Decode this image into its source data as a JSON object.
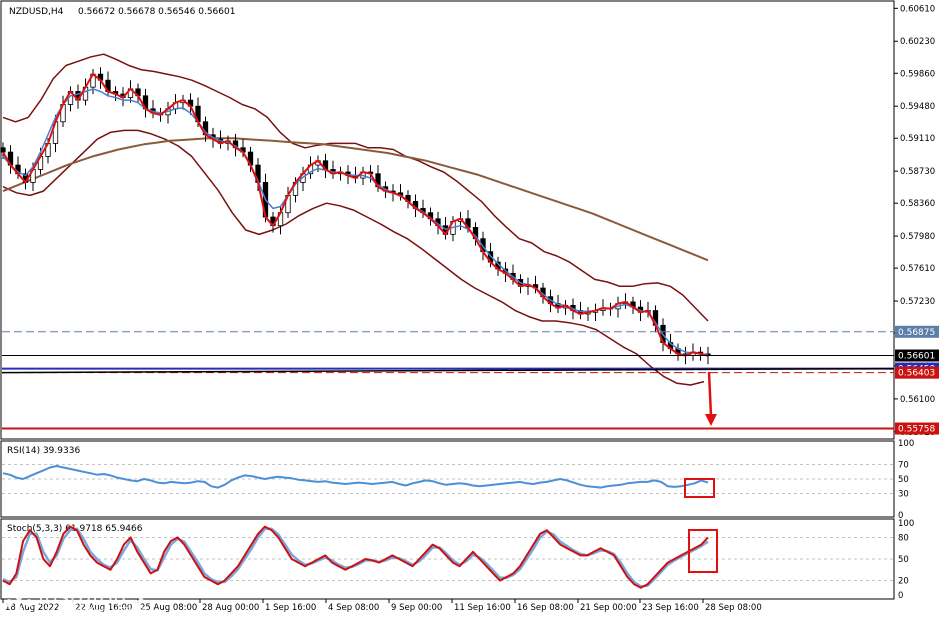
{
  "chart_data": {
    "type": "candlestick",
    "header": {
      "symbol": "NZDUSD,H4",
      "ohlc": "0.56672 0.56678 0.56546 0.56601"
    },
    "price_axis": {
      "ticks": [
        "0.60610",
        "0.60230",
        "0.59860",
        "0.59480",
        "0.59110",
        "0.58730",
        "0.58360",
        "0.57980",
        "0.57610",
        "0.57230",
        "0.56860",
        "0.56480",
        "0.56100",
        "0.55720"
      ],
      "ylim": [
        0.5566,
        0.6066
      ]
    },
    "time_axis": {
      "labels": [
        "18 Aug 2022",
        "22 Aug 16:00",
        "25 Aug 08:00",
        "28 Aug 00:00",
        "1 Sep 16:00",
        "4 Sep 08:00",
        "9 Sep 00:00",
        "11 Sep 16:00",
        "16 Sep 08:00",
        "21 Sep 00:00",
        "23 Sep 16:00",
        "28 Sep 08:00"
      ]
    },
    "series": {
      "close_path": [
        0.5895,
        0.588,
        0.587,
        0.586,
        0.5875,
        0.589,
        0.5905,
        0.593,
        0.595,
        0.5965,
        0.5955,
        0.597,
        0.5985,
        0.5978,
        0.5965,
        0.5962,
        0.5958,
        0.5968,
        0.596,
        0.5945,
        0.594,
        0.5938,
        0.5945,
        0.5952,
        0.5955,
        0.5948,
        0.593,
        0.5915,
        0.591,
        0.5905,
        0.5908,
        0.59,
        0.5895,
        0.588,
        0.586,
        0.582,
        0.581,
        0.5825,
        0.5845,
        0.586,
        0.587,
        0.588,
        0.5885,
        0.5875,
        0.587,
        0.5872,
        0.5868,
        0.5865,
        0.5872,
        0.587,
        0.5855,
        0.585,
        0.5848,
        0.5845,
        0.5838,
        0.583,
        0.5825,
        0.5818,
        0.581,
        0.58,
        0.5815,
        0.5818,
        0.5808,
        0.5795,
        0.578,
        0.5768,
        0.576,
        0.5755,
        0.5748,
        0.574,
        0.5742,
        0.5738,
        0.5728,
        0.572,
        0.5715,
        0.5718,
        0.5712,
        0.5708,
        0.571,
        0.5712,
        0.5715,
        0.5714,
        0.572,
        0.5722,
        0.5716,
        0.571,
        0.5712,
        0.5695,
        0.5675,
        0.5668,
        0.5662,
        0.566,
        0.5664,
        0.5662,
        0.566
      ],
      "ma_short": [
        0.589,
        0.588,
        0.5872,
        0.5868,
        0.5878,
        0.5895,
        0.5915,
        0.5935,
        0.595,
        0.596,
        0.5962,
        0.5965,
        0.5968,
        0.5965,
        0.596,
        0.5958,
        0.5955,
        0.5955,
        0.5952,
        0.5945,
        0.5942,
        0.594,
        0.5942,
        0.5945,
        0.5946,
        0.594,
        0.593,
        0.5918,
        0.5912,
        0.5908,
        0.5906,
        0.5902,
        0.5895,
        0.588,
        0.5862,
        0.584,
        0.583,
        0.5832,
        0.5845,
        0.5858,
        0.5866,
        0.5872,
        0.5876,
        0.5874,
        0.5872,
        0.5871,
        0.5869,
        0.5868,
        0.5868,
        0.5865,
        0.5857,
        0.5852,
        0.5848,
        0.5844,
        0.5838,
        0.5831,
        0.5826,
        0.5819,
        0.5812,
        0.5806,
        0.5808,
        0.581,
        0.5806,
        0.5798,
        0.5786,
        0.5775,
        0.5766,
        0.5758,
        0.5751,
        0.5744,
        0.5742,
        0.5738,
        0.5731,
        0.5724,
        0.5719,
        0.5718,
        0.5714,
        0.5711,
        0.5711,
        0.5712,
        0.5714,
        0.5714,
        0.5717,
        0.5719,
        0.5716,
        0.5712,
        0.571,
        0.5698,
        0.5684,
        0.5674,
        0.5668,
        0.5664,
        0.5663,
        0.5662,
        0.5661
      ],
      "ma_long": [
        0.585,
        0.5856,
        0.5862,
        0.5868,
        0.5874,
        0.588,
        0.5885,
        0.589,
        0.5894,
        0.5898,
        0.5901,
        0.5904,
        0.5906,
        0.5908,
        0.5909,
        0.591,
        0.5911,
        0.5911,
        0.5911,
        0.591,
        0.5909,
        0.5908,
        0.5907,
        0.5906,
        0.5905,
        0.5904,
        0.5902,
        0.59,
        0.5898,
        0.5896,
        0.5894,
        0.5891,
        0.5888,
        0.5885,
        0.5881,
        0.5877,
        0.5873,
        0.5869,
        0.5864,
        0.5859,
        0.5854,
        0.5849,
        0.5844,
        0.5839,
        0.5834,
        0.5829,
        0.5824,
        0.5818,
        0.5812,
        0.5806,
        0.58,
        0.5794,
        0.5788,
        0.5782,
        0.5776,
        0.577
      ],
      "bb_upper": [
        0.5935,
        0.593,
        0.5935,
        0.5955,
        0.598,
        0.5995,
        0.6,
        0.6005,
        0.6008,
        0.6002,
        0.5995,
        0.599,
        0.5988,
        0.5985,
        0.5982,
        0.5978,
        0.5972,
        0.5965,
        0.5958,
        0.595,
        0.5945,
        0.5935,
        0.5918,
        0.5905,
        0.59,
        0.5903,
        0.5905,
        0.5905,
        0.5905,
        0.59,
        0.59,
        0.5898,
        0.589,
        0.5885,
        0.5878,
        0.5872,
        0.5862,
        0.585,
        0.5838,
        0.5822,
        0.5808,
        0.5795,
        0.579,
        0.578,
        0.5775,
        0.5768,
        0.5758,
        0.5748,
        0.5745,
        0.574,
        0.574,
        0.5743,
        0.5744,
        0.574,
        0.573,
        0.5715,
        0.57
      ],
      "bb_lower": [
        0.5855,
        0.5848,
        0.5845,
        0.585,
        0.5865,
        0.588,
        0.5895,
        0.591,
        0.5918,
        0.592,
        0.592,
        0.5916,
        0.591,
        0.5902,
        0.589,
        0.587,
        0.585,
        0.5825,
        0.5805,
        0.58,
        0.5805,
        0.5812,
        0.5822,
        0.583,
        0.5836,
        0.5833,
        0.5828,
        0.582,
        0.5812,
        0.5803,
        0.5795,
        0.5784,
        0.5772,
        0.576,
        0.5748,
        0.5738,
        0.573,
        0.5722,
        0.5712,
        0.5705,
        0.57,
        0.57,
        0.5698,
        0.5695,
        0.569,
        0.568,
        0.567,
        0.5662,
        0.5648,
        0.5636,
        0.5628,
        0.5626,
        0.563
      ],
      "rsi": [
        58,
        56,
        52,
        50,
        54,
        58,
        62,
        66,
        68,
        66,
        64,
        62,
        60,
        58,
        56,
        57,
        55,
        52,
        50,
        48,
        47,
        50,
        48,
        45,
        44,
        46,
        45,
        44,
        45,
        47,
        46,
        40,
        38,
        42,
        48,
        52,
        55,
        54,
        52,
        50,
        52,
        53,
        52,
        51,
        49,
        48,
        47,
        46,
        47,
        45,
        44,
        43,
        44,
        45,
        44,
        43,
        44,
        45,
        46,
        43,
        41,
        44,
        46,
        48,
        47,
        44,
        42,
        43,
        44,
        43,
        41,
        40,
        41,
        42,
        43,
        44,
        45,
        46,
        44,
        43,
        45,
        46,
        48,
        50,
        48,
        45,
        42,
        40,
        39,
        38,
        40,
        41,
        42,
        44,
        45,
        46,
        46,
        48,
        46,
        40,
        39,
        40,
        42,
        44,
        48,
        45
      ],
      "stoch_main": [
        20,
        15,
        30,
        75,
        90,
        80,
        50,
        40,
        60,
        85,
        95,
        90,
        70,
        55,
        45,
        40,
        35,
        50,
        70,
        80,
        60,
        45,
        30,
        35,
        60,
        75,
        80,
        70,
        55,
        40,
        25,
        20,
        15,
        20,
        30,
        40,
        55,
        70,
        85,
        95,
        90,
        80,
        65,
        50,
        45,
        40,
        45,
        50,
        55,
        45,
        40,
        35,
        40,
        45,
        50,
        48,
        45,
        50,
        55,
        50,
        45,
        40,
        50,
        60,
        70,
        65,
        55,
        45,
        40,
        50,
        60,
        50,
        40,
        30,
        20,
        25,
        30,
        40,
        55,
        70,
        85,
        90,
        80,
        70,
        65,
        60,
        55,
        55,
        60,
        65,
        60,
        55,
        40,
        25,
        15,
        10,
        15,
        25,
        35,
        45,
        50,
        55,
        60,
        65,
        70,
        80
      ],
      "stoch_signal": [
        22,
        18,
        25,
        60,
        85,
        85,
        60,
        45,
        55,
        78,
        90,
        92,
        78,
        60,
        50,
        42,
        38,
        45,
        62,
        76,
        66,
        50,
        36,
        34,
        52,
        70,
        78,
        74,
        60,
        46,
        30,
        22,
        18,
        18,
        26,
        36,
        50,
        64,
        80,
        92,
        92,
        84,
        70,
        56,
        48,
        42,
        44,
        48,
        52,
        48,
        42,
        38,
        39,
        43,
        48,
        48,
        46,
        48,
        52,
        51,
        47,
        42,
        47,
        56,
        66,
        66,
        58,
        48,
        42,
        47,
        56,
        52,
        44,
        34,
        24,
        24,
        28,
        36,
        50,
        64,
        80,
        88,
        84,
        74,
        68,
        62,
        57,
        55,
        58,
        62,
        61,
        57,
        45,
        30,
        18,
        12,
        13,
        22,
        32,
        42,
        48,
        53,
        58,
        63,
        68,
        74
      ],
      "rsi_label": "RSI(14) 39.9336",
      "stoch_label": "Stoch(5,3,3) 61.9718 65.9466",
      "rsi_axis": [
        "100",
        "70",
        "50",
        "30",
        "0"
      ],
      "stoch_axis": [
        "100",
        "80",
        "50",
        "20",
        "0"
      ]
    },
    "levels": [
      {
        "price": "0.56875",
        "color": "#5b7fa6",
        "style": "dashed"
      },
      {
        "price": "0.56601",
        "color": "#000000",
        "style": "solid"
      },
      {
        "price": "0.56450",
        "color": "#2b2bb8",
        "style": "solid"
      },
      {
        "price": "0.56403",
        "color": "#cc1111",
        "style": "dashed"
      },
      {
        "price": "0.55758",
        "color": "#cc1111",
        "style": "solid"
      }
    ],
    "colors": {
      "candle": "#000000",
      "ma_red": "#e01010",
      "ma_blue": "#4a7fd0",
      "ma_brown": "#8b5a3c",
      "bollinger": "#7a1010",
      "rsi_line": "#4a90d9",
      "stoch_main": "#cc1111",
      "stoch_signal": "#7aa7de",
      "highlight_box": "#e01010",
      "arrow": "#e01010"
    },
    "watermark": {
      "brand": "instaforex",
      "tagline": "Instant Forex Trading"
    }
  }
}
